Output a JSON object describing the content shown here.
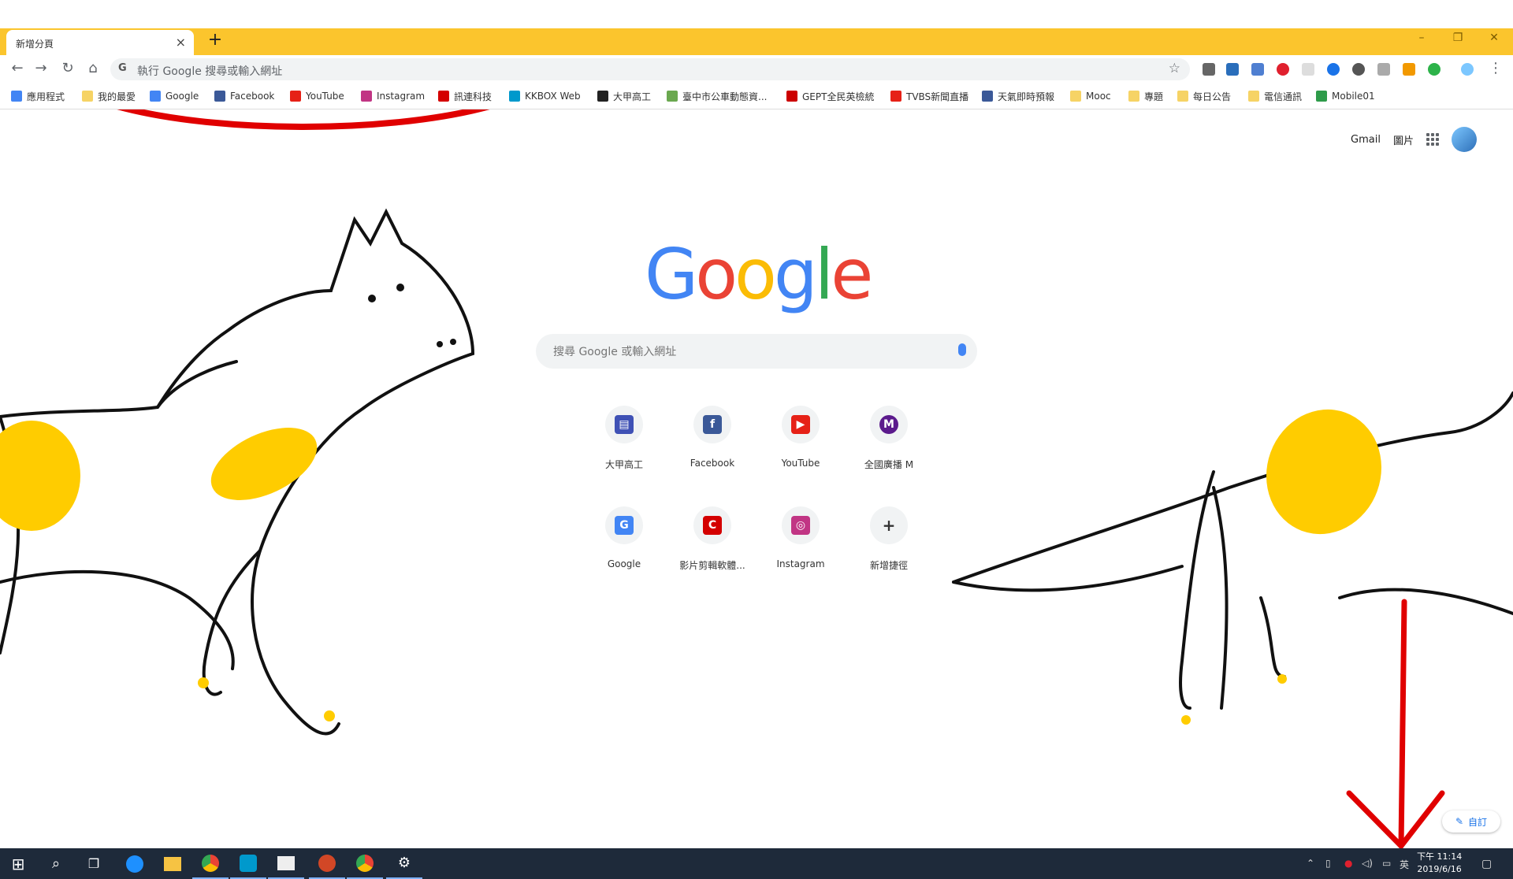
{
  "tab": {
    "title": "新增分頁",
    "close": "×"
  },
  "newtab": "+",
  "window": {
    "minimize": "–",
    "restore": "❐",
    "close": "✕"
  },
  "toolbar": {
    "back": "←",
    "forward": "→",
    "reload": "↻",
    "home": "⌂",
    "omnibox_placeholder": "執行 Google 搜尋或輸入網址",
    "star": "☆",
    "menu": "⋮"
  },
  "bookmarks": [
    {
      "label": "應用程式",
      "icon": "apps-icon",
      "color": "#4285f4"
    },
    {
      "label": "我的最愛",
      "icon": "folder-icon",
      "color": "#f6d365"
    },
    {
      "label": "Google",
      "icon": "google-icon",
      "color": "#4285f4"
    },
    {
      "label": "Facebook",
      "icon": "facebook-icon",
      "color": "#3b5998"
    },
    {
      "label": "YouTube",
      "icon": "youtube-icon",
      "color": "#e62117"
    },
    {
      "label": "Instagram",
      "icon": "instagram-icon",
      "color": "#c13584"
    },
    {
      "label": "訊連科技",
      "icon": "cyberlink-icon",
      "color": "#d40000"
    },
    {
      "label": "KKBOX Web",
      "icon": "kkbox-icon",
      "color": "#09c"
    },
    {
      "label": "大甲高工",
      "icon": "school-icon",
      "color": "#222"
    },
    {
      "label": "臺中市公車動態資...",
      "icon": "bus-icon",
      "color": "#6aa84f"
    },
    {
      "label": "GEPT全民英檢統",
      "icon": "gept-icon",
      "color": "#c00"
    },
    {
      "label": "TVBS新聞直播",
      "icon": "youtube-icon",
      "color": "#e62117"
    },
    {
      "label": "天氣即時預報",
      "icon": "facebook-icon",
      "color": "#3b5998"
    },
    {
      "label": "Mooc",
      "icon": "folder-icon",
      "color": "#f6d365"
    },
    {
      "label": "專題",
      "icon": "folder-icon",
      "color": "#f6d365"
    },
    {
      "label": "每日公告",
      "icon": "folder-icon",
      "color": "#f6d365"
    },
    {
      "label": "電信通訊",
      "icon": "folder-icon",
      "color": "#f6d365"
    },
    {
      "label": "Mobile01",
      "icon": "mobile01-icon",
      "color": "#2e9b4a"
    }
  ],
  "toplinks": {
    "gmail": "Gmail",
    "images": "圖片"
  },
  "logo": [
    "G",
    "o",
    "o",
    "g",
    "l",
    "e"
  ],
  "search": {
    "placeholder": "搜尋 Google 或輸入網址"
  },
  "shortcuts": [
    {
      "label": "大甲高工",
      "glyph": "▤",
      "color": "#3f51b5"
    },
    {
      "label": "Facebook",
      "glyph": "f",
      "color": "#3b5998"
    },
    {
      "label": "YouTube",
      "glyph": "▶",
      "color": "#e62117"
    },
    {
      "label": "全國廣播 M",
      "glyph": "M",
      "color": "#5b1a8c"
    },
    {
      "label": "Google",
      "glyph": "G",
      "color": "#4285f4"
    },
    {
      "label": "影片剪輯軟體...",
      "glyph": "C",
      "color": "#d40000"
    },
    {
      "label": "Instagram",
      "glyph": "◎",
      "color": "#c13584"
    },
    {
      "label": "新增捷徑",
      "glyph": "+",
      "color": "#555"
    }
  ],
  "customize": {
    "label": "自訂",
    "icon": "✎"
  },
  "taskbar": {
    "start": "⊞",
    "search": "⌕",
    "taskview": "❐",
    "tray_lang": "英",
    "time": "下午 11:14",
    "date": "2019/6/16"
  },
  "colors": {
    "tabstrip": "#fbc52d",
    "annotation": "#e00000",
    "horse_spot": "#ffcc00"
  }
}
